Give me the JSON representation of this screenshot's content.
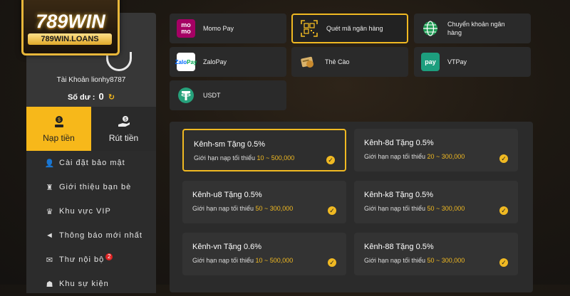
{
  "logo": {
    "main": "789WIN",
    "sub": "789WIN.LOANS"
  },
  "profile": {
    "account_label": "Tài Khoản lionhy8787",
    "balance_label": "Số dư :",
    "balance_value": "0"
  },
  "tabs": [
    {
      "label": "Nạp tiền",
      "icon": "deposit-icon",
      "active": true
    },
    {
      "label": "Rút tiền",
      "icon": "withdraw-icon",
      "active": false
    }
  ],
  "menu": [
    {
      "label": "Cài đặt bảo mật",
      "icon": "user-settings-icon"
    },
    {
      "label": "Giới thiệu bạn bè",
      "icon": "friends-icon"
    },
    {
      "label": "Khu vực VIP",
      "icon": "crown-icon"
    },
    {
      "label": "Thông báo mới nhất",
      "icon": "megaphone-icon"
    },
    {
      "label": "Thư nội bộ",
      "icon": "mail-icon",
      "badge": "2"
    },
    {
      "label": "Khu sự kiện",
      "icon": "trophy-icon"
    }
  ],
  "payment_methods": [
    {
      "label": "Momo Pay",
      "icon": "momo-icon",
      "icon_text": "mo\nmo"
    },
    {
      "label": "Quét mã ngân hàng",
      "icon": "qr-code-icon",
      "selected": true
    },
    {
      "label": "Chuyển khoản ngân hàng",
      "icon": "globe-icon"
    },
    {
      "label": "ZaloPay",
      "icon": "zalopay-icon",
      "icon_text": "Zalo\nPay"
    },
    {
      "label": "Thẻ Cào",
      "icon": "card-icon"
    },
    {
      "label": "VTPay",
      "icon": "vtpay-icon",
      "icon_text": "pay"
    },
    {
      "label": "USDT",
      "icon": "tether-icon"
    }
  ],
  "channels": {
    "limit_label": "Giới hạn nạp tối thiểu",
    "items": [
      {
        "title": "Kênh-sm Tặng 0.5%",
        "range": "10 ~ 500,000",
        "selected": true
      },
      {
        "title": "Kênh-8d Tặng 0.5%",
        "range": "20 ~ 300,000"
      },
      {
        "title": "Kênh-u8 Tặng 0.5%",
        "range": "50 ~ 300,000"
      },
      {
        "title": "Kênh-k8 Tặng 0.5%",
        "range": "50 ~ 300,000"
      },
      {
        "title": "Kênh-vn Tặng 0.6%",
        "range": "10 ~ 500,000"
      },
      {
        "title": "Kênh-88 Tặng 0.5%",
        "range": "50 ~ 300,000"
      }
    ]
  },
  "colors": {
    "accent": "#f0b922",
    "panel": "#2b2b2b",
    "badge": "#e02424"
  }
}
